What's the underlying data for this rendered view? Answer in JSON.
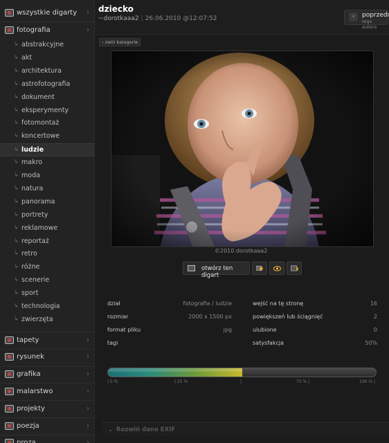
{
  "sidebar": {
    "top_category": {
      "label": "wszystkie digarty",
      "icon": "folder-icon"
    },
    "open_category": {
      "label": "fotografia",
      "icon": "camera-icon"
    },
    "subcategories": [
      {
        "label": "abstrakcyjne",
        "active": false
      },
      {
        "label": "akt",
        "active": false
      },
      {
        "label": "architektura",
        "active": false
      },
      {
        "label": "astrofotografia",
        "active": false
      },
      {
        "label": "dokument",
        "active": false
      },
      {
        "label": "eksperymenty",
        "active": false
      },
      {
        "label": "fotomontaż",
        "active": false
      },
      {
        "label": "koncertowe",
        "active": false
      },
      {
        "label": "ludzie",
        "active": true
      },
      {
        "label": "makro",
        "active": false
      },
      {
        "label": "moda",
        "active": false
      },
      {
        "label": "natura",
        "active": false
      },
      {
        "label": "panorama",
        "active": false
      },
      {
        "label": "portrety",
        "active": false
      },
      {
        "label": "reklamowe",
        "active": false
      },
      {
        "label": "reportaż",
        "active": false
      },
      {
        "label": "retro",
        "active": false
      },
      {
        "label": "różne",
        "active": false
      },
      {
        "label": "scenerie",
        "active": false
      },
      {
        "label": "sport",
        "active": false
      },
      {
        "label": "technologia",
        "active": false
      },
      {
        "label": "zwierzęta",
        "active": false
      }
    ],
    "other_categories": [
      {
        "label": "tapety"
      },
      {
        "label": "rysunek"
      },
      {
        "label": "grafika"
      },
      {
        "label": "malarstwo"
      },
      {
        "label": "projekty"
      },
      {
        "label": "poezja"
      },
      {
        "label": "proza"
      }
    ]
  },
  "header": {
    "title": "dziecko",
    "author": "~dorotkaaa2",
    "date": "26.06.2010 @12:07:52",
    "prev_label": "poprzedni",
    "prev_sub": "tego autora"
  },
  "collapse_label": "zwiń kategorie",
  "photo": {
    "watermark": "©2010 dorotkaaa2"
  },
  "actions": {
    "open_label": "otwórz ten digart"
  },
  "stats_left": [
    {
      "label": "dział",
      "value": "fotografia / ludzie"
    },
    {
      "label": "rozmiar",
      "value": "2000 x 1500 px"
    },
    {
      "label": "format pliku",
      "value": "jpg"
    },
    {
      "label": "tagi",
      "value": ""
    }
  ],
  "stats_right": [
    {
      "label": "wejść na tę stronę",
      "value": "16"
    },
    {
      "label": "powiększeń lub ściągnięć",
      "value": "2"
    },
    {
      "label": "ulubione",
      "value": "0"
    },
    {
      "label": "satysfakcja",
      "value": "50%"
    }
  ],
  "rating": {
    "fraction": 0.5,
    "scale": [
      "| 0 %",
      "| 25 %",
      "|",
      "75 % |",
      "100 % |"
    ]
  },
  "exif_label": "Rozwiń dane EXIF",
  "colors": {
    "accent": "#e8a833",
    "bg": "#1b1b1b",
    "sidebar": "#232323"
  }
}
